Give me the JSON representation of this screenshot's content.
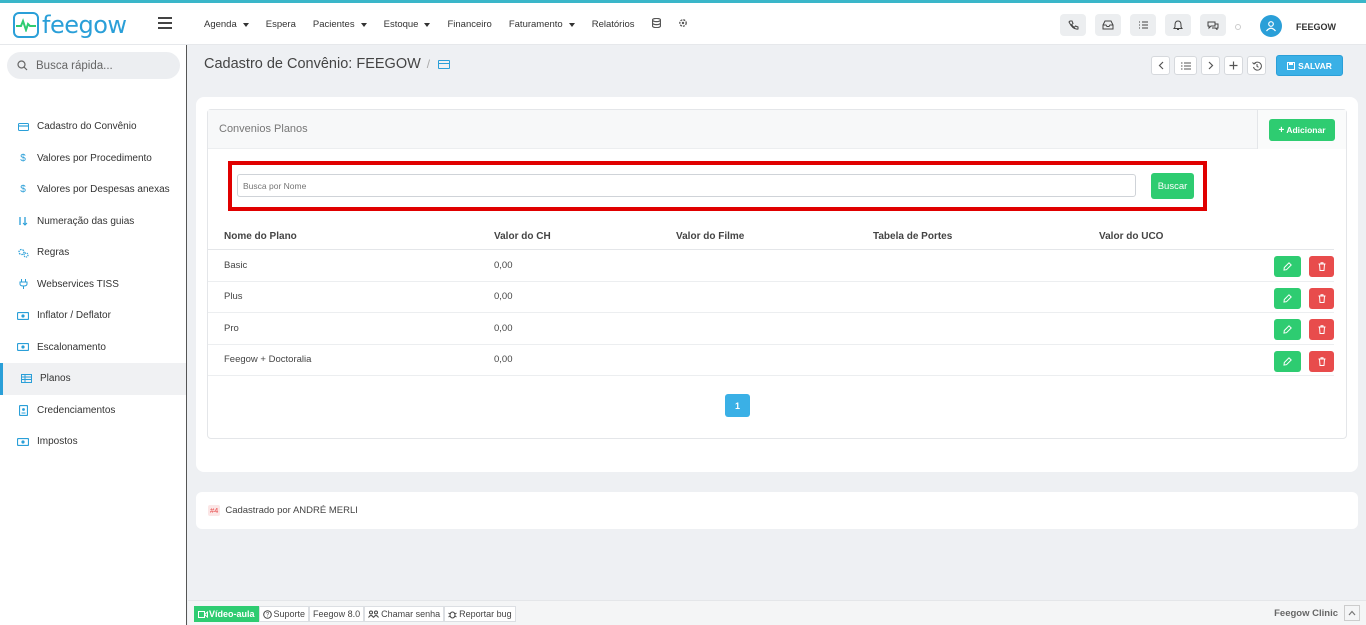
{
  "app": {
    "logo_text": "feegow",
    "username": "FEEGOW",
    "accent": "#2a9fd8"
  },
  "nav": {
    "items": [
      {
        "label": "Agenda",
        "dropdown": true
      },
      {
        "label": "Espera",
        "dropdown": false
      },
      {
        "label": "Pacientes",
        "dropdown": true
      },
      {
        "label": "Estoque",
        "dropdown": true
      },
      {
        "label": "Financeiro",
        "dropdown": false
      },
      {
        "label": "Faturamento",
        "dropdown": true
      },
      {
        "label": "Relatórios",
        "dropdown": false
      }
    ],
    "icons": [
      "database-icon",
      "gear-icon"
    ],
    "top_actions": [
      "phone-icon",
      "inbox-icon",
      "tasks-icon",
      "bell-icon",
      "chat-icon"
    ]
  },
  "sidebar": {
    "search_placeholder": "Busca rápida...",
    "items": [
      {
        "label": "Cadastro do Convênio",
        "icon": "credit-card-icon",
        "active": false
      },
      {
        "label": "Valores por Procedimento",
        "icon": "dollar-icon",
        "active": false
      },
      {
        "label": "Valores por Despesas anexas",
        "icon": "dollar-icon",
        "active": false
      },
      {
        "label": "Numeração das guias",
        "icon": "sort-numeric-icon",
        "active": false
      },
      {
        "label": "Regras",
        "icon": "cogs-icon",
        "active": false
      },
      {
        "label": "Webservices TISS",
        "icon": "plug-icon",
        "active": false
      },
      {
        "label": "Inflator / Deflator",
        "icon": "money-icon",
        "active": false
      },
      {
        "label": "Escalonamento",
        "icon": "money-icon",
        "active": false
      },
      {
        "label": "Planos",
        "icon": "table-icon",
        "active": true
      },
      {
        "label": "Credenciamentos",
        "icon": "id-badge-icon",
        "active": false
      },
      {
        "label": "Impostos",
        "icon": "money-icon",
        "active": false
      }
    ]
  },
  "header": {
    "title": "Cadastro de Convênio: FEEGOW",
    "separator": "/",
    "save_label": "SALVAR"
  },
  "plans": {
    "section_title": "Convenios Planos",
    "add_label": "Adicionar",
    "search_placeholder": "Busca por Nome",
    "search_button": "Buscar",
    "columns": [
      "Nome do Plano",
      "Valor do CH",
      "Valor do Filme",
      "Tabela de Portes",
      "Valor do UCO"
    ],
    "rows": [
      [
        "Basic",
        "0,00",
        "",
        "",
        ""
      ],
      [
        "Plus",
        "0,00",
        "",
        "",
        ""
      ],
      [
        "Pro",
        "0,00",
        "",
        "",
        ""
      ],
      [
        "Feegow + Doctoralia",
        "0,00",
        "",
        "",
        ""
      ]
    ],
    "current_page": "1"
  },
  "registry": {
    "id": "#4",
    "text": "Cadastrado por ANDRÉ MERLI"
  },
  "footer": {
    "video": "Vídeo-aula",
    "support": "Suporte",
    "version": "Feegow 8.0",
    "call": "Chamar senha",
    "bug": "Reportar bug",
    "brand": "Feegow Clinic"
  }
}
